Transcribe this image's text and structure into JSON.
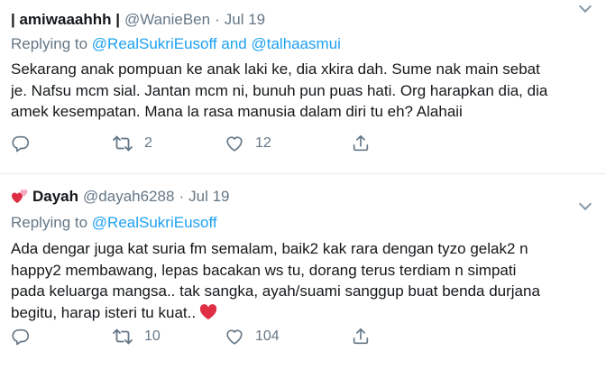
{
  "tweets": [
    {
      "name": "| amiwaaahhh |",
      "handle": "@WanieBen",
      "separator": "·",
      "date": "Jul 19",
      "replying_prefix": "Replying to",
      "replying_mentions": [
        "@RealSukriEusoff",
        "@talhaasmui"
      ],
      "replying_joiner": "and",
      "body_lines": [
        "Sekarang anak pompuan ke anak laki ke, dia xkira dah. Sume nak main sebat",
        "je. Nafsu mcm sial. Jantan mcm ni, bunuh pun puas hati. Org harapkan dia, dia",
        "amek kesempatan. Mana la rasa manusia dalam diri tu eh? Alahaii"
      ],
      "replies": "",
      "retweets": "2",
      "likes": "12"
    },
    {
      "name_emoji": "two-hearts-icon",
      "name": "Dayah",
      "handle": "@dayah6288",
      "separator": "·",
      "date": "Jul 19",
      "replying_prefix": "Replying to",
      "replying_mentions": [
        "@RealSukriEusoff"
      ],
      "body_lines": [
        "Ada dengar juga kat suria fm semalam, baik2 kak rara dengan tyzo gelak2 n",
        "happy2 membawang, lepas bacakan ws tu, dorang terus terdiam n simpati",
        "pada keluarga mangsa.. tak sangka, ayah/suami sanggup buat benda durjana",
        "begitu, harap isteri tu kuat.."
      ],
      "body_trailing_emoji": "red-heart-icon",
      "replies": "",
      "retweets": "10",
      "likes": "104"
    }
  ],
  "colors": {
    "text": "#14171a",
    "secondary": "#657786",
    "link": "#1da1f2",
    "divider": "#e6ecf0",
    "heart_red": "#e0245e"
  }
}
